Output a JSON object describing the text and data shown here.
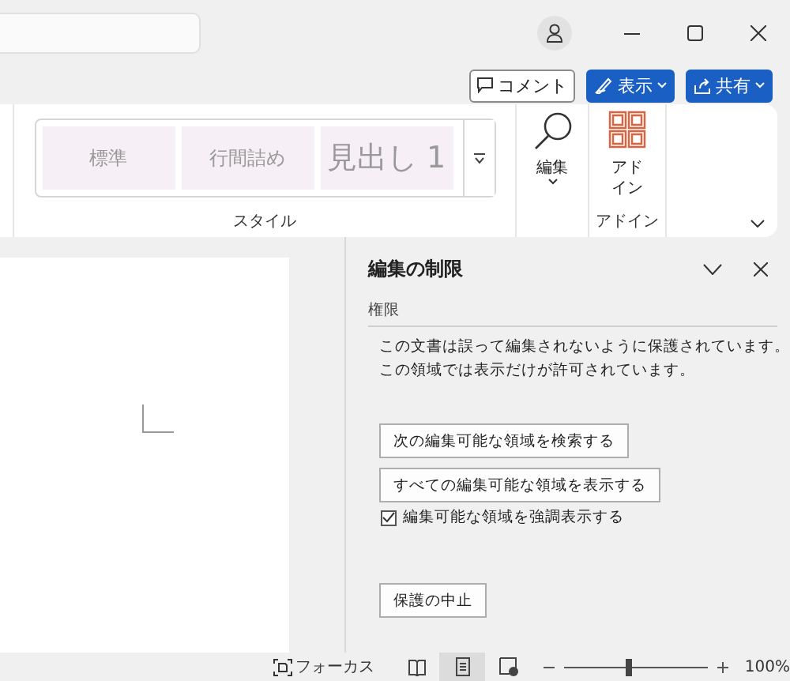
{
  "header_buttons": [
    {
      "kind": "comment",
      "label": "コメント"
    },
    {
      "kind": "view",
      "label": "表示"
    },
    {
      "kind": "share",
      "label": "共有"
    }
  ],
  "ribbon": {
    "styles": [
      "標準",
      "行間詰め",
      "見出し 1"
    ],
    "style_group": "スタイル",
    "editing": "編集",
    "addins": [
      "アド",
      "イン"
    ],
    "addin_group": "アドイン"
  },
  "pane": {
    "title": "編集の制限",
    "section": "権限",
    "message": [
      "この文書は誤って編集されないように保護されています。",
      "この領域では表示だけが許可されています。"
    ],
    "buttons": [
      "次の編集可能な領域を検索する",
      "すべての編集可能な領域を表示する"
    ],
    "highlight": {
      "label": "編集可能な領域を強調表示する",
      "checked": true
    },
    "stop_button": "保護の中止"
  },
  "status_bar": {
    "focus": "フォーカス",
    "views": [
      {
        "kind": "read",
        "selected": false
      },
      {
        "kind": "print",
        "selected": true
      },
      {
        "kind": "web",
        "selected": false
      }
    ],
    "zoom": {
      "level": 0.45
    },
    "zoom_text": "100%"
  }
}
